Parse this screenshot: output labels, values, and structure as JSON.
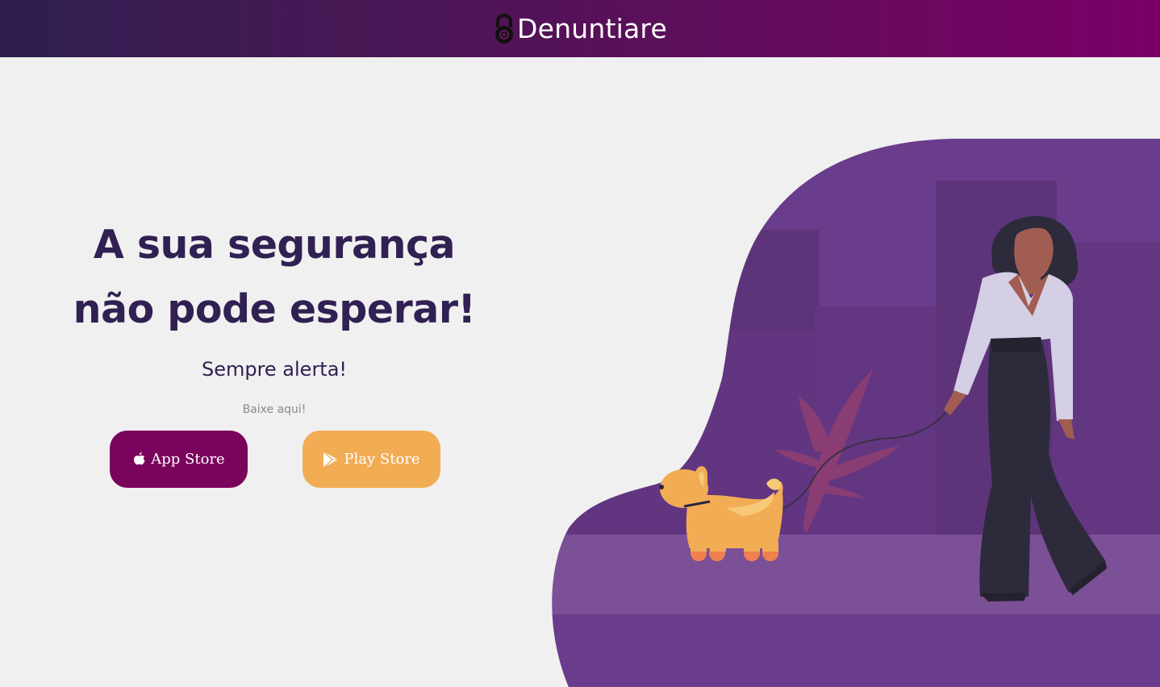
{
  "header": {
    "brand_name": "Denuntiare",
    "logo_icon": "padlock-icon",
    "gradient": [
      "#2e1f50",
      "#7a0068"
    ]
  },
  "hero": {
    "title_line1": "A sua segurança",
    "title_line2": "não pode esperar!",
    "tagline": "Sempre alerta!",
    "download_label": "Baixe aqui!",
    "text_color": "#312052"
  },
  "stores": {
    "appstore": {
      "label": "App Store",
      "icon": "apple-icon",
      "color": "#7a045c"
    },
    "playstore": {
      "label": "Play Store",
      "icon": "play-store-icon",
      "color": "#f2ac54"
    }
  },
  "illustration": {
    "subject": "woman-walking-dog",
    "background_color": "#6a3b8c"
  }
}
